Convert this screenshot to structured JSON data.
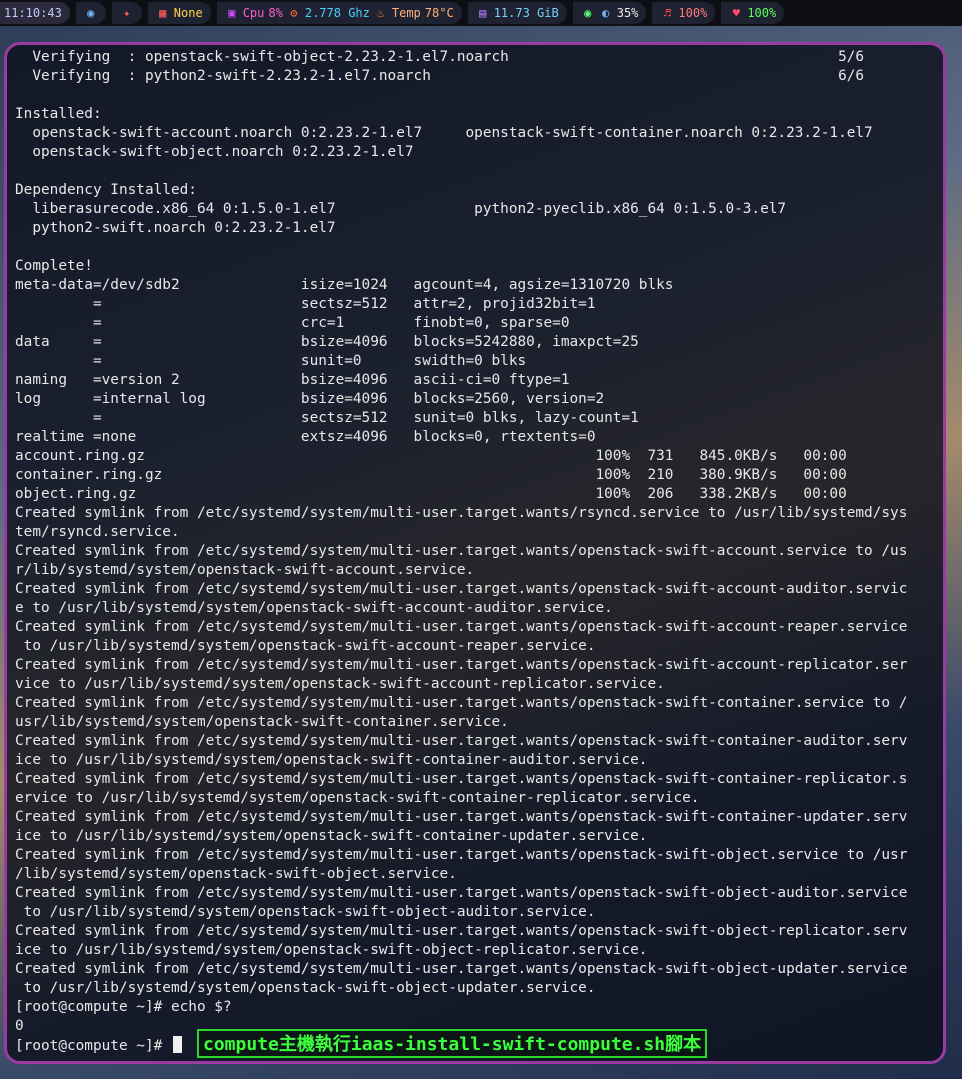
{
  "topbar": {
    "clock": "11:10:43",
    "network_label": "None",
    "cpu_label": "Cpu",
    "cpu_percent": "8%",
    "cpu_freq": "2.778 Ghz",
    "temp_label": "Temp",
    "temp_value": "78°C",
    "memory": "11.73 GiB",
    "brightness": "35%",
    "volume": "100%",
    "battery": "100%"
  },
  "terminal": {
    "lines": [
      "  Verifying  : openstack-swift-object-2.23.2-1.el7.noarch                                      5/6",
      "  Verifying  : python2-swift-2.23.2-1.el7.noarch                                               6/6",
      "",
      "Installed:",
      "  openstack-swift-account.noarch 0:2.23.2-1.el7     openstack-swift-container.noarch 0:2.23.2-1.el7",
      "  openstack-swift-object.noarch 0:2.23.2-1.el7",
      "",
      "Dependency Installed:",
      "  liberasurecode.x86_64 0:1.5.0-1.el7                python2-pyeclib.x86_64 0:1.5.0-3.el7",
      "  python2-swift.noarch 0:2.23.2-1.el7",
      "",
      "Complete!",
      "meta-data=/dev/sdb2              isize=1024   agcount=4, agsize=1310720 blks",
      "         =                       sectsz=512   attr=2, projid32bit=1",
      "         =                       crc=1        finobt=0, sparse=0",
      "data     =                       bsize=4096   blocks=5242880, imaxpct=25",
      "         =                       sunit=0      swidth=0 blks",
      "naming   =version 2              bsize=4096   ascii-ci=0 ftype=1",
      "log      =internal log           bsize=4096   blocks=2560, version=2",
      "         =                       sectsz=512   sunit=0 blks, lazy-count=1",
      "realtime =none                   extsz=4096   blocks=0, rtextents=0",
      "account.ring.gz                                                    100%  731   845.0KB/s   00:00",
      "container.ring.gz                                                  100%  210   380.9KB/s   00:00",
      "object.ring.gz                                                     100%  206   338.2KB/s   00:00",
      "Created symlink from /etc/systemd/system/multi-user.target.wants/rsyncd.service to /usr/lib/systemd/sys",
      "tem/rsyncd.service.",
      "Created symlink from /etc/systemd/system/multi-user.target.wants/openstack-swift-account.service to /us",
      "r/lib/systemd/system/openstack-swift-account.service.",
      "Created symlink from /etc/systemd/system/multi-user.target.wants/openstack-swift-account-auditor.servic",
      "e to /usr/lib/systemd/system/openstack-swift-account-auditor.service.",
      "Created symlink from /etc/systemd/system/multi-user.target.wants/openstack-swift-account-reaper.service",
      " to /usr/lib/systemd/system/openstack-swift-account-reaper.service.",
      "Created symlink from /etc/systemd/system/multi-user.target.wants/openstack-swift-account-replicator.ser",
      "vice to /usr/lib/systemd/system/openstack-swift-account-replicator.service.",
      "Created symlink from /etc/systemd/system/multi-user.target.wants/openstack-swift-container.service to /",
      "usr/lib/systemd/system/openstack-swift-container.service.",
      "Created symlink from /etc/systemd/system/multi-user.target.wants/openstack-swift-container-auditor.serv",
      "ice to /usr/lib/systemd/system/openstack-swift-container-auditor.service.",
      "Created symlink from /etc/systemd/system/multi-user.target.wants/openstack-swift-container-replicator.s",
      "ervice to /usr/lib/systemd/system/openstack-swift-container-replicator.service.",
      "Created symlink from /etc/systemd/system/multi-user.target.wants/openstack-swift-container-updater.serv",
      "ice to /usr/lib/systemd/system/openstack-swift-container-updater.service.",
      "Created symlink from /etc/systemd/system/multi-user.target.wants/openstack-swift-object.service to /usr",
      "/lib/systemd/system/openstack-swift-object.service.",
      "Created symlink from /etc/systemd/system/multi-user.target.wants/openstack-swift-object-auditor.service",
      " to /usr/lib/systemd/system/openstack-swift-object-auditor.service.",
      "Created symlink from /etc/systemd/system/multi-user.target.wants/openstack-swift-object-replicator.serv",
      "ice to /usr/lib/systemd/system/openstack-swift-object-replicator.service.",
      "Created symlink from /etc/systemd/system/multi-user.target.wants/openstack-swift-object-updater.service",
      " to /usr/lib/systemd/system/openstack-swift-object-updater.service.",
      "[root@compute ~]# echo $?",
      "0"
    ],
    "prompt": "[root@compute ~]# ",
    "annotation": "compute主機執行iaas-install-swift-compute.sh腳本"
  },
  "colors": {
    "terminal_border": "#9b3aa1",
    "annotation_green": "#3cff3c"
  }
}
